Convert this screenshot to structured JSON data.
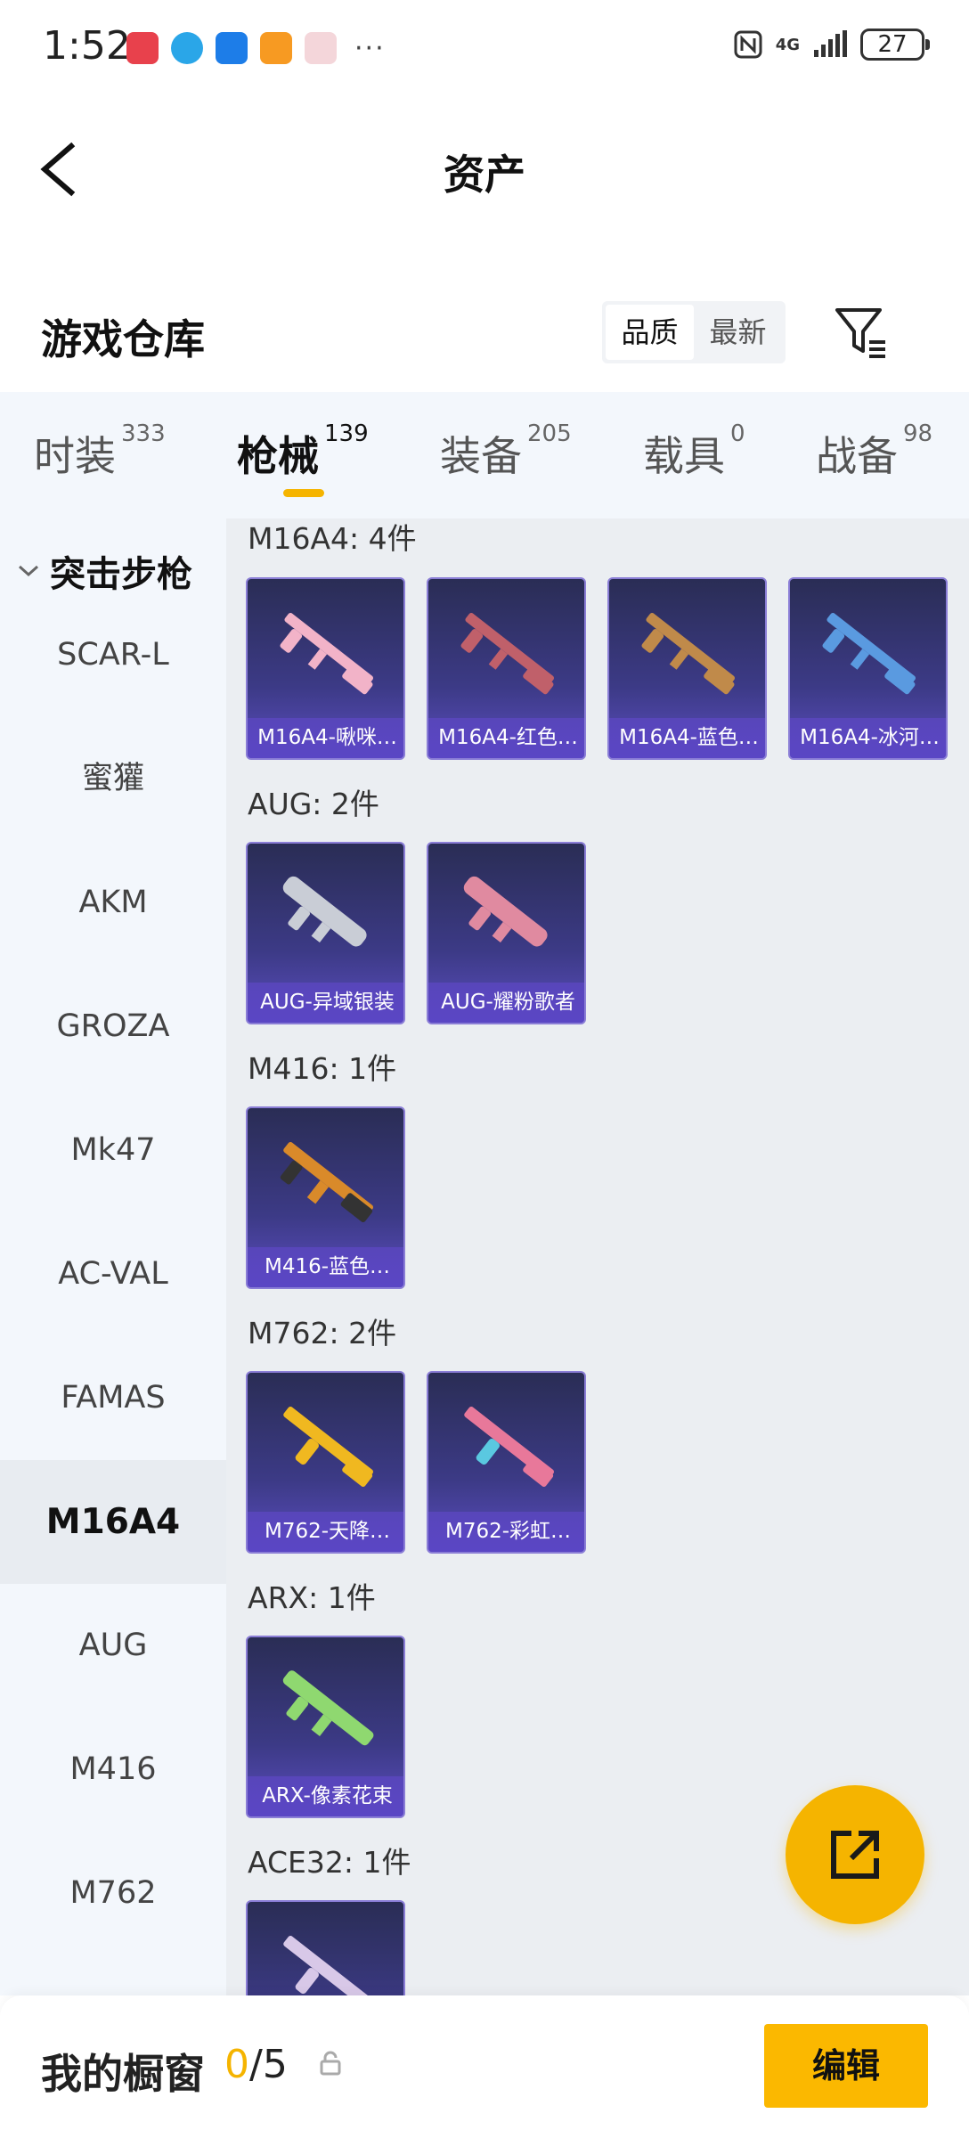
{
  "status_bar": {
    "time": "1:52",
    "more": "···",
    "network": "4G",
    "battery": "27"
  },
  "nav": {
    "title": "资产"
  },
  "warehouse": {
    "title": "游戏仓库",
    "sort_options": [
      "品质",
      "最新"
    ],
    "sort_selected": "品质"
  },
  "tabs": [
    {
      "label": "时装",
      "count": "333"
    },
    {
      "label": "枪械",
      "count": "139"
    },
    {
      "label": "装备",
      "count": "205"
    },
    {
      "label": "载具",
      "count": "0"
    },
    {
      "label": "战备",
      "count": "98"
    }
  ],
  "sidebar": {
    "group": "突击步枪",
    "items": [
      "SCAR-L",
      "蜜獾",
      "AKM",
      "GROZA",
      "Mk47",
      "AC-VAL",
      "FAMAS",
      "M16A4",
      "AUG",
      "M416",
      "M762"
    ],
    "active": "M16A4"
  },
  "sections": [
    {
      "title": "M16A4: 4件",
      "items": [
        {
          "name": "M16A4-啾咪…",
          "icon": "rifle-pink-icon",
          "color": "#f2b3c8"
        },
        {
          "name": "M16A4-红色…",
          "icon": "rifle-red-icon",
          "color": "#c0606a"
        },
        {
          "name": "M16A4-蓝色…",
          "icon": "rifle-blue-dark-icon",
          "color": "#c08a4a"
        },
        {
          "name": "M16A4-冰河…",
          "icon": "rifle-ice-icon",
          "color": "#5a9ae0"
        }
      ]
    },
    {
      "title": "AUG: 2件",
      "items": [
        {
          "name": "AUG-异域银装",
          "icon": "aug-silver-icon",
          "color": "#c9cdd6"
        },
        {
          "name": "AUG-耀粉歌者",
          "icon": "aug-pink-icon",
          "color": "#e08aa0"
        }
      ]
    },
    {
      "title": "M416: 1件",
      "items": [
        {
          "name": "M416-蓝色…",
          "icon": "m416-orange-icon",
          "color": "#d98a2a"
        }
      ]
    },
    {
      "title": "M762: 2件",
      "items": [
        {
          "name": "M762-天降…",
          "icon": "m762-gold-icon",
          "color": "#f0b820"
        },
        {
          "name": "M762-彩虹…",
          "icon": "m762-rainbow-icon",
          "color": "#e8789a"
        }
      ]
    },
    {
      "title": "ARX: 1件",
      "items": [
        {
          "name": "ARX-像素花束",
          "icon": "arx-green-icon",
          "color": "#8fd870"
        }
      ]
    },
    {
      "title": "ACE32: 1件",
      "items": [
        {
          "name": "",
          "icon": "ace32-icon",
          "color": "#d8c8e8"
        }
      ]
    }
  ],
  "showcase": {
    "label": "我的橱窗",
    "used": "0",
    "total": "/5"
  },
  "edit_button": "编辑",
  "colors": {
    "accent": "#f5b400",
    "card_purple": "#5a46c4"
  }
}
